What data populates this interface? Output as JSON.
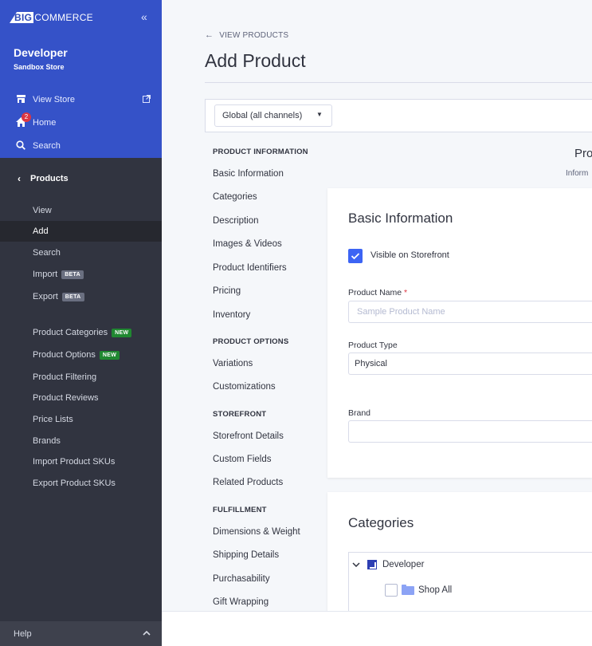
{
  "sidebar": {
    "logo": {
      "prefix": "BIG",
      "rest": "COMMERCE"
    },
    "collapse_icon": "double-chevron-left-icon",
    "store_name": "Developer",
    "store_sub": "Sandbox Store",
    "view_store": "View Store",
    "home": "Home",
    "home_badge": "2",
    "search": "Search",
    "section": "Products",
    "items": [
      {
        "label": "View"
      },
      {
        "label": "Add",
        "active": true
      },
      {
        "label": "Search"
      },
      {
        "label": "Import",
        "tag": "BETA"
      },
      {
        "label": "Export",
        "tag": "BETA"
      },
      {
        "label": "Product Categories",
        "tag": "NEW"
      },
      {
        "label": "Product Options",
        "tag": "NEW"
      },
      {
        "label": "Product Filtering"
      },
      {
        "label": "Product Reviews"
      },
      {
        "label": "Price Lists"
      },
      {
        "label": "Brands"
      },
      {
        "label": "Import Product SKUs"
      },
      {
        "label": "Export Product SKUs"
      }
    ],
    "help": "Help"
  },
  "header": {
    "back_label": "VIEW PRODUCTS",
    "title": "Add Product",
    "channel_select": "Global (all channels)"
  },
  "nav": {
    "sections": [
      {
        "title": "PRODUCT INFORMATION",
        "items": [
          "Basic Information",
          "Categories",
          "Description",
          "Images & Videos",
          "Product Identifiers",
          "Pricing",
          "Inventory"
        ]
      },
      {
        "title": "PRODUCT OPTIONS",
        "items": [
          "Variations",
          "Customizations"
        ]
      },
      {
        "title": "STOREFRONT",
        "items": [
          "Storefront Details",
          "Custom Fields",
          "Related Products"
        ]
      },
      {
        "title": "FULFILLMENT",
        "items": [
          "Dimensions & Weight",
          "Shipping Details",
          "Purchasability",
          "Gift Wrapping"
        ]
      }
    ]
  },
  "preview": {
    "title": "Pro",
    "subtitle": "Inform"
  },
  "basic_info": {
    "title": "Basic Information",
    "visible_label": "Visible on Storefront",
    "visible_checked": true,
    "product_name_label": "Product Name",
    "required_mark": "*",
    "product_name_placeholder": "Sample Product Name",
    "product_type_label": "Product Type",
    "product_type_value": "Physical",
    "brand_label": "Brand",
    "brand_value": ""
  },
  "categories": {
    "title": "Categories",
    "tree": [
      {
        "label": "Developer",
        "expanded": true
      },
      {
        "label": "Shop All",
        "checked": false
      }
    ]
  },
  "colors": {
    "sidebar": "#313440",
    "sidebar_top": "#3552c8",
    "accent": "#3c64f4",
    "new_badge": "#208831",
    "notification": "#db3643"
  }
}
